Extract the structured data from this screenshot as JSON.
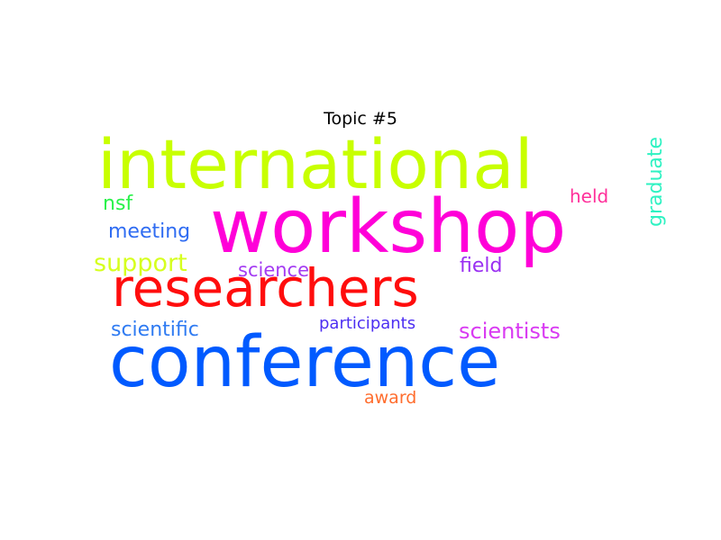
{
  "figure": {
    "title": "Topic #5"
  },
  "wordcloud": {
    "words": [
      {
        "text": "international",
        "color": "#c8ff00"
      },
      {
        "text": "workshop",
        "color": "#ff00d8"
      },
      {
        "text": "researchers",
        "color": "#ff0d0d"
      },
      {
        "text": "conference",
        "color": "#005aff"
      },
      {
        "text": "nsf",
        "color": "#29f24a"
      },
      {
        "text": "meeting",
        "color": "#2f6cf2"
      },
      {
        "text": "support",
        "color": "#d6ff1f"
      },
      {
        "text": "science",
        "color": "#a43bf2"
      },
      {
        "text": "field",
        "color": "#9a2ff2"
      },
      {
        "text": "held",
        "color": "#ff2f9a"
      },
      {
        "text": "graduate",
        "color": "#2ef2c2"
      },
      {
        "text": "scientific",
        "color": "#2f7bf2"
      },
      {
        "text": "participants",
        "color": "#4d2ff2"
      },
      {
        "text": "scientists",
        "color": "#d93bf2"
      },
      {
        "text": "award",
        "color": "#ff6d2e"
      }
    ]
  }
}
